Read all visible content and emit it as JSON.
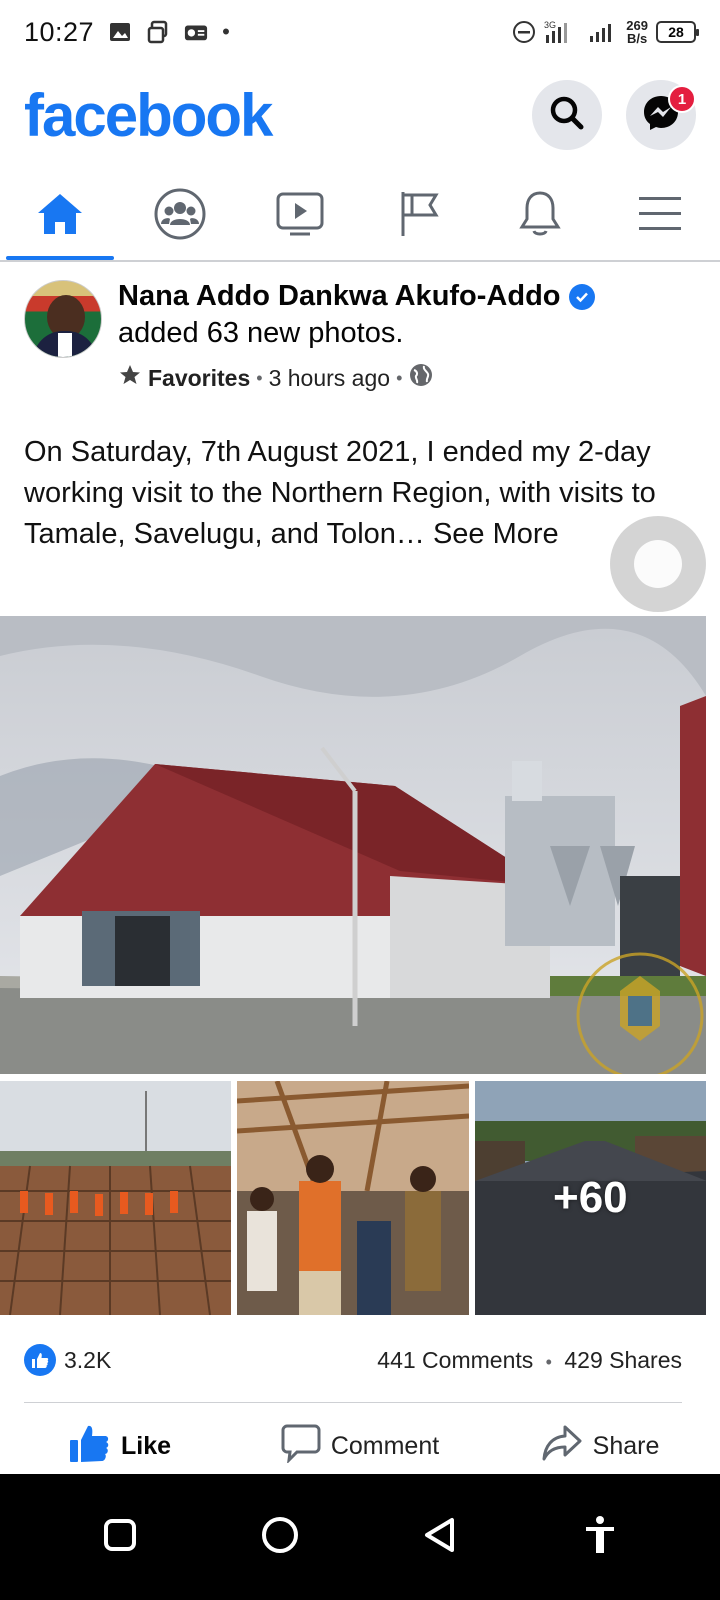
{
  "status_bar": {
    "time": "10:27",
    "net_speed_value": "269",
    "net_speed_unit": "B/s",
    "network_type": "3G",
    "battery": "28",
    "dot": "•"
  },
  "header": {
    "logo": "facebook",
    "messenger_badge": "1"
  },
  "nav_tabs": [
    "home",
    "groups",
    "watch",
    "pages",
    "notifications",
    "menu"
  ],
  "post": {
    "author": "Nana Addo Dankwa Akufo-Addo",
    "action": "added 63 new photos.",
    "audience_label": "Favorites",
    "time": "3 hours ago",
    "privacy": "public",
    "text": "On Saturday, 7th August 2021, I ended my 2-day working visit to the Northern Region, with visits to Tamale, Savelugu, and Tolon…",
    "see_more": "See More",
    "more_photos": "+60",
    "likes": "3.2K",
    "comments": "441 Comments",
    "shares": "429 Shares",
    "separator": "•"
  },
  "actions": {
    "like": "Like",
    "comment": "Comment",
    "share": "Share"
  },
  "colors": {
    "brand": "#1877f2",
    "badge": "#e41e3f"
  }
}
